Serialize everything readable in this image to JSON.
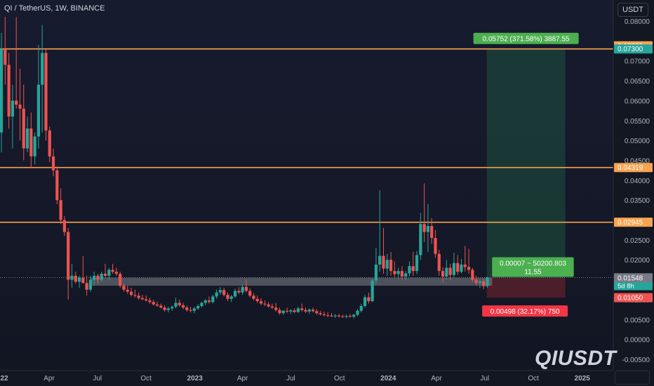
{
  "header": {
    "symbol": "QI / TetherUS, 1W, BINANCE"
  },
  "currency_button": "USDT",
  "watermark": "QIUSDT",
  "chart_data": {
    "type": "candlestick",
    "y_ticks": [
      "0.08000",
      "0.07000",
      "0.06500",
      "0.06000",
      "0.05500",
      "0.05000",
      "0.04500",
      "0.04000",
      "0.03500",
      "0.03000",
      "0.02500",
      "0.02000",
      "0.01500",
      "0.01000",
      "0.00500",
      "0.00000",
      "-0.00500"
    ],
    "x_ticks": [
      {
        "label": "22",
        "date": "2022-01",
        "bold": true
      },
      {
        "label": "Apr",
        "date": "2022-04"
      },
      {
        "label": "Jul",
        "date": "2022-07"
      },
      {
        "label": "Oct",
        "date": "2022-10"
      },
      {
        "label": "2023",
        "date": "2023-01",
        "bold": true
      },
      {
        "label": "Apr",
        "date": "2023-04"
      },
      {
        "label": "Jul",
        "date": "2023-07"
      },
      {
        "label": "Oct",
        "date": "2023-10"
      },
      {
        "label": "2024",
        "date": "2024-01",
        "bold": true
      },
      {
        "label": "Apr",
        "date": "2024-04"
      },
      {
        "label": "Jul",
        "date": "2024-07"
      },
      {
        "label": "Oct",
        "date": "2024-10"
      },
      {
        "label": "2025",
        "date": "2025-01",
        "bold": true
      }
    ],
    "ylim": [
      -0.006,
      0.081
    ],
    "horizontal_lines": [
      0.073,
      0.04319,
      0.02945
    ],
    "colors": {
      "up": "#26a69a",
      "down": "#ef5350",
      "level": "#f7a350",
      "bull": "#4caf50",
      "bear": "#f23645"
    },
    "price_labels": [
      {
        "price": "0.07378",
        "value": 0.07378,
        "color": "#f7a350"
      },
      {
        "price": "0.07300",
        "value": 0.073,
        "color": "#26a69a"
      },
      {
        "price": "0.04319",
        "value": 0.04319,
        "color": "#f7a350"
      },
      {
        "price": "0.02945",
        "value": 0.02945,
        "color": "#f7a350"
      },
      {
        "price": "0.01555",
        "sub": "5d 8h",
        "value": 0.01555,
        "color": "#26a69a"
      },
      {
        "price": "0.01548",
        "value": 0.01548,
        "color": "#787b86"
      },
      {
        "price": "0.01050",
        "value": 0.0105,
        "color": "#ef5350"
      }
    ],
    "position": {
      "entry": 0.01548,
      "target": 0.073,
      "stop": 0.0105,
      "start_date": "2024-07-05",
      "end_date": "2024-11-30",
      "target_text": "0.05752 (371.58%) 3887.55",
      "center_text_1": "0.00007 ~ 50200.803",
      "center_text_2": "11.55",
      "stop_text": "0.00498 (32.17%) 750"
    },
    "zone": {
      "low": 0.0135,
      "high": 0.0155,
      "start_date": "2022-06-18",
      "end_date": "2024-07-15"
    },
    "candles": [
      {
        "d": "2021-12-25",
        "o": 0.0765,
        "h": 0.081,
        "l": 0.0475,
        "c": 0.052
      },
      {
        "d": "2022-01-01",
        "o": 0.052,
        "h": 0.077,
        "l": 0.047,
        "c": 0.073
      },
      {
        "d": "2022-01-08",
        "o": 0.073,
        "h": 0.081,
        "l": 0.064,
        "c": 0.069
      },
      {
        "d": "2022-01-15",
        "o": 0.069,
        "h": 0.072,
        "l": 0.053,
        "c": 0.056
      },
      {
        "d": "2022-01-22",
        "o": 0.056,
        "h": 0.064,
        "l": 0.048,
        "c": 0.06
      },
      {
        "d": "2022-01-29",
        "o": 0.06,
        "h": 0.081,
        "l": 0.058,
        "c": 0.059
      },
      {
        "d": "2022-02-05",
        "o": 0.059,
        "h": 0.068,
        "l": 0.05,
        "c": 0.058
      },
      {
        "d": "2022-02-12",
        "o": 0.058,
        "h": 0.064,
        "l": 0.045,
        "c": 0.048
      },
      {
        "d": "2022-02-19",
        "o": 0.048,
        "h": 0.056,
        "l": 0.047,
        "c": 0.053
      },
      {
        "d": "2022-02-26",
        "o": 0.053,
        "h": 0.057,
        "l": 0.043,
        "c": 0.046
      },
      {
        "d": "2022-03-05",
        "o": 0.046,
        "h": 0.052,
        "l": 0.044,
        "c": 0.051
      },
      {
        "d": "2022-03-12",
        "o": 0.051,
        "h": 0.074,
        "l": 0.048,
        "c": 0.064
      },
      {
        "d": "2022-03-19",
        "o": 0.064,
        "h": 0.079,
        "l": 0.052,
        "c": 0.072
      },
      {
        "d": "2022-03-26",
        "o": 0.072,
        "h": 0.073,
        "l": 0.05,
        "c": 0.0525
      },
      {
        "d": "2022-04-02",
        "o": 0.0525,
        "h": 0.0535,
        "l": 0.0445,
        "c": 0.046
      },
      {
        "d": "2022-04-09",
        "o": 0.046,
        "h": 0.048,
        "l": 0.041,
        "c": 0.0425
      },
      {
        "d": "2022-04-16",
        "o": 0.0425,
        "h": 0.0435,
        "l": 0.034,
        "c": 0.035
      },
      {
        "d": "2022-04-23",
        "o": 0.035,
        "h": 0.038,
        "l": 0.029,
        "c": 0.03
      },
      {
        "d": "2022-04-30",
        "o": 0.03,
        "h": 0.031,
        "l": 0.026,
        "c": 0.027
      },
      {
        "d": "2022-05-07",
        "o": 0.027,
        "h": 0.028,
        "l": 0.01,
        "c": 0.015
      },
      {
        "d": "2022-05-14",
        "o": 0.015,
        "h": 0.019,
        "l": 0.013,
        "c": 0.016
      },
      {
        "d": "2022-05-21",
        "o": 0.016,
        "h": 0.017,
        "l": 0.014,
        "c": 0.0145
      },
      {
        "d": "2022-05-28",
        "o": 0.0145,
        "h": 0.016,
        "l": 0.013,
        "c": 0.0155
      },
      {
        "d": "2022-06-04",
        "o": 0.0155,
        "h": 0.021,
        "l": 0.014,
        "c": 0.0142
      },
      {
        "d": "2022-06-11",
        "o": 0.0142,
        "h": 0.016,
        "l": 0.011,
        "c": 0.0125
      },
      {
        "d": "2022-06-18",
        "o": 0.0125,
        "h": 0.016,
        "l": 0.012,
        "c": 0.015
      },
      {
        "d": "2022-06-25",
        "o": 0.015,
        "h": 0.017,
        "l": 0.0135,
        "c": 0.016
      },
      {
        "d": "2022-07-02",
        "o": 0.016,
        "h": 0.0165,
        "l": 0.014,
        "c": 0.015
      },
      {
        "d": "2022-07-09",
        "o": 0.015,
        "h": 0.017,
        "l": 0.0145,
        "c": 0.0165
      },
      {
        "d": "2022-07-16",
        "o": 0.0165,
        "h": 0.019,
        "l": 0.0155,
        "c": 0.016
      },
      {
        "d": "2022-07-23",
        "o": 0.016,
        "h": 0.018,
        "l": 0.015,
        "c": 0.0175
      },
      {
        "d": "2022-07-30",
        "o": 0.0175,
        "h": 0.019,
        "l": 0.0165,
        "c": 0.017
      },
      {
        "d": "2022-08-06",
        "o": 0.017,
        "h": 0.018,
        "l": 0.016,
        "c": 0.0165
      },
      {
        "d": "2022-08-13",
        "o": 0.0165,
        "h": 0.017,
        "l": 0.013,
        "c": 0.0135
      },
      {
        "d": "2022-08-20",
        "o": 0.0135,
        "h": 0.014,
        "l": 0.012,
        "c": 0.0125
      },
      {
        "d": "2022-08-27",
        "o": 0.0125,
        "h": 0.0135,
        "l": 0.0115,
        "c": 0.012
      },
      {
        "d": "2022-09-03",
        "o": 0.012,
        "h": 0.013,
        "l": 0.0108,
        "c": 0.0112
      },
      {
        "d": "2022-09-10",
        "o": 0.0112,
        "h": 0.0125,
        "l": 0.0105,
        "c": 0.011
      },
      {
        "d": "2022-09-17",
        "o": 0.011,
        "h": 0.0118,
        "l": 0.01,
        "c": 0.0104
      },
      {
        "d": "2022-09-24",
        "o": 0.0104,
        "h": 0.0112,
        "l": 0.0098,
        "c": 0.0101
      },
      {
        "d": "2022-10-01",
        "o": 0.0101,
        "h": 0.011,
        "l": 0.0095,
        "c": 0.0098
      },
      {
        "d": "2022-10-08",
        "o": 0.0098,
        "h": 0.0105,
        "l": 0.009,
        "c": 0.0094
      },
      {
        "d": "2022-10-15",
        "o": 0.0094,
        "h": 0.01,
        "l": 0.0085,
        "c": 0.0088
      },
      {
        "d": "2022-10-22",
        "o": 0.0088,
        "h": 0.0095,
        "l": 0.0082,
        "c": 0.0085
      },
      {
        "d": "2022-10-29",
        "o": 0.0085,
        "h": 0.009,
        "l": 0.0078,
        "c": 0.008
      },
      {
        "d": "2022-11-05",
        "o": 0.008,
        "h": 0.0086,
        "l": 0.007,
        "c": 0.0074
      },
      {
        "d": "2022-11-12",
        "o": 0.0074,
        "h": 0.0082,
        "l": 0.0068,
        "c": 0.0078
      },
      {
        "d": "2022-11-19",
        "o": 0.0078,
        "h": 0.0085,
        "l": 0.0072,
        "c": 0.0082
      },
      {
        "d": "2022-11-26",
        "o": 0.0082,
        "h": 0.0105,
        "l": 0.0078,
        "c": 0.0092
      },
      {
        "d": "2022-12-03",
        "o": 0.0092,
        "h": 0.01,
        "l": 0.0082,
        "c": 0.0086
      },
      {
        "d": "2022-12-10",
        "o": 0.0086,
        "h": 0.0092,
        "l": 0.0076,
        "c": 0.008
      },
      {
        "d": "2022-12-17",
        "o": 0.008,
        "h": 0.0085,
        "l": 0.007,
        "c": 0.0074
      },
      {
        "d": "2022-12-24",
        "o": 0.0074,
        "h": 0.0082,
        "l": 0.0068,
        "c": 0.0072
      },
      {
        "d": "2022-12-31",
        "o": 0.0072,
        "h": 0.0082,
        "l": 0.0066,
        "c": 0.0078
      },
      {
        "d": "2023-01-07",
        "o": 0.0078,
        "h": 0.0088,
        "l": 0.0074,
        "c": 0.0084
      },
      {
        "d": "2023-01-14",
        "o": 0.0084,
        "h": 0.0095,
        "l": 0.008,
        "c": 0.0092
      },
      {
        "d": "2023-01-21",
        "o": 0.0092,
        "h": 0.0102,
        "l": 0.0086,
        "c": 0.0098
      },
      {
        "d": "2023-01-28",
        "o": 0.0098,
        "h": 0.0108,
        "l": 0.009,
        "c": 0.0094
      },
      {
        "d": "2023-02-04",
        "o": 0.0094,
        "h": 0.0112,
        "l": 0.009,
        "c": 0.0108
      },
      {
        "d": "2023-02-11",
        "o": 0.0108,
        "h": 0.0125,
        "l": 0.0102,
        "c": 0.0118
      },
      {
        "d": "2023-02-18",
        "o": 0.0118,
        "h": 0.0132,
        "l": 0.0112,
        "c": 0.0124
      },
      {
        "d": "2023-02-25",
        "o": 0.0124,
        "h": 0.013,
        "l": 0.0108,
        "c": 0.0112
      },
      {
        "d": "2023-03-04",
        "o": 0.0112,
        "h": 0.0118,
        "l": 0.0096,
        "c": 0.0102
      },
      {
        "d": "2023-03-11",
        "o": 0.0102,
        "h": 0.0112,
        "l": 0.0094,
        "c": 0.0108
      },
      {
        "d": "2023-03-18",
        "o": 0.0108,
        "h": 0.0128,
        "l": 0.0104,
        "c": 0.0122
      },
      {
        "d": "2023-03-25",
        "o": 0.0122,
        "h": 0.0132,
        "l": 0.0114,
        "c": 0.0118
      },
      {
        "d": "2023-04-01",
        "o": 0.0118,
        "h": 0.0138,
        "l": 0.0112,
        "c": 0.0132
      },
      {
        "d": "2023-04-08",
        "o": 0.0132,
        "h": 0.015,
        "l": 0.0118,
        "c": 0.0122
      },
      {
        "d": "2023-04-15",
        "o": 0.0122,
        "h": 0.0128,
        "l": 0.0106,
        "c": 0.011
      },
      {
        "d": "2023-04-22",
        "o": 0.011,
        "h": 0.0116,
        "l": 0.0098,
        "c": 0.0102
      },
      {
        "d": "2023-04-29",
        "o": 0.0102,
        "h": 0.011,
        "l": 0.0092,
        "c": 0.0096
      },
      {
        "d": "2023-05-06",
        "o": 0.0096,
        "h": 0.0104,
        "l": 0.0086,
        "c": 0.009
      },
      {
        "d": "2023-05-13",
        "o": 0.009,
        "h": 0.0098,
        "l": 0.0084,
        "c": 0.0088
      },
      {
        "d": "2023-05-20",
        "o": 0.0088,
        "h": 0.0094,
        "l": 0.008,
        "c": 0.0083
      },
      {
        "d": "2023-05-27",
        "o": 0.0083,
        "h": 0.009,
        "l": 0.0076,
        "c": 0.008
      },
      {
        "d": "2023-06-03",
        "o": 0.008,
        "h": 0.0092,
        "l": 0.007,
        "c": 0.0074
      },
      {
        "d": "2023-06-10",
        "o": 0.0074,
        "h": 0.008,
        "l": 0.0062,
        "c": 0.0066
      },
      {
        "d": "2023-06-17",
        "o": 0.0066,
        "h": 0.0074,
        "l": 0.0062,
        "c": 0.0072
      },
      {
        "d": "2023-06-24",
        "o": 0.0072,
        "h": 0.008,
        "l": 0.0066,
        "c": 0.007
      },
      {
        "d": "2023-07-01",
        "o": 0.007,
        "h": 0.0076,
        "l": 0.0064,
        "c": 0.0073
      },
      {
        "d": "2023-07-08",
        "o": 0.0073,
        "h": 0.0078,
        "l": 0.0066,
        "c": 0.0069
      },
      {
        "d": "2023-07-15",
        "o": 0.0069,
        "h": 0.0082,
        "l": 0.0066,
        "c": 0.0078
      },
      {
        "d": "2023-07-22",
        "o": 0.0078,
        "h": 0.009,
        "l": 0.007,
        "c": 0.0074
      },
      {
        "d": "2023-07-29",
        "o": 0.0074,
        "h": 0.008,
        "l": 0.0066,
        "c": 0.007
      },
      {
        "d": "2023-08-05",
        "o": 0.007,
        "h": 0.0078,
        "l": 0.0064,
        "c": 0.0075
      },
      {
        "d": "2023-08-12",
        "o": 0.0075,
        "h": 0.008,
        "l": 0.0068,
        "c": 0.0071
      },
      {
        "d": "2023-08-19",
        "o": 0.0071,
        "h": 0.0076,
        "l": 0.0062,
        "c": 0.0066
      },
      {
        "d": "2023-08-26",
        "o": 0.0066,
        "h": 0.0072,
        "l": 0.006,
        "c": 0.0063
      },
      {
        "d": "2023-09-02",
        "o": 0.0063,
        "h": 0.007,
        "l": 0.0058,
        "c": 0.0061
      },
      {
        "d": "2023-09-09",
        "o": 0.0061,
        "h": 0.0068,
        "l": 0.0056,
        "c": 0.006
      },
      {
        "d": "2023-09-16",
        "o": 0.006,
        "h": 0.0066,
        "l": 0.0056,
        "c": 0.0058
      },
      {
        "d": "2023-09-23",
        "o": 0.0058,
        "h": 0.0064,
        "l": 0.0054,
        "c": 0.006
      },
      {
        "d": "2023-09-30",
        "o": 0.006,
        "h": 0.0064,
        "l": 0.0055,
        "c": 0.0058
      },
      {
        "d": "2023-10-07",
        "o": 0.0058,
        "h": 0.0062,
        "l": 0.0054,
        "c": 0.0057
      },
      {
        "d": "2023-10-14",
        "o": 0.0057,
        "h": 0.0062,
        "l": 0.0053,
        "c": 0.0059
      },
      {
        "d": "2023-10-21",
        "o": 0.0059,
        "h": 0.0064,
        "l": 0.0055,
        "c": 0.0057
      },
      {
        "d": "2023-10-28",
        "o": 0.0057,
        "h": 0.0064,
        "l": 0.0053,
        "c": 0.0062
      },
      {
        "d": "2023-11-04",
        "o": 0.0062,
        "h": 0.0076,
        "l": 0.0058,
        "c": 0.0072
      },
      {
        "d": "2023-11-11",
        "o": 0.0072,
        "h": 0.009,
        "l": 0.0068,
        "c": 0.0084
      },
      {
        "d": "2023-11-18",
        "o": 0.0084,
        "h": 0.0112,
        "l": 0.008,
        "c": 0.0106
      },
      {
        "d": "2023-11-25",
        "o": 0.0106,
        "h": 0.0118,
        "l": 0.009,
        "c": 0.0096
      },
      {
        "d": "2023-12-02",
        "o": 0.0096,
        "h": 0.0152,
        "l": 0.0094,
        "c": 0.0148
      },
      {
        "d": "2023-12-09",
        "o": 0.0148,
        "h": 0.023,
        "l": 0.014,
        "c": 0.0188
      },
      {
        "d": "2023-12-16",
        "o": 0.0188,
        "h": 0.0375,
        "l": 0.017,
        "c": 0.021
      },
      {
        "d": "2023-12-23",
        "o": 0.021,
        "h": 0.028,
        "l": 0.0165,
        "c": 0.0178
      },
      {
        "d": "2023-12-30",
        "o": 0.0178,
        "h": 0.0215,
        "l": 0.016,
        "c": 0.02
      },
      {
        "d": "2024-01-06",
        "o": 0.02,
        "h": 0.022,
        "l": 0.016,
        "c": 0.0172
      },
      {
        "d": "2024-01-13",
        "o": 0.0172,
        "h": 0.0196,
        "l": 0.0156,
        "c": 0.0164
      },
      {
        "d": "2024-01-20",
        "o": 0.0164,
        "h": 0.018,
        "l": 0.0152,
        "c": 0.0172
      },
      {
        "d": "2024-01-27",
        "o": 0.0172,
        "h": 0.0184,
        "l": 0.015,
        "c": 0.0158
      },
      {
        "d": "2024-02-03",
        "o": 0.0158,
        "h": 0.0172,
        "l": 0.0148,
        "c": 0.0166
      },
      {
        "d": "2024-02-10",
        "o": 0.0166,
        "h": 0.0196,
        "l": 0.0158,
        "c": 0.0184
      },
      {
        "d": "2024-02-17",
        "o": 0.0184,
        "h": 0.022,
        "l": 0.016,
        "c": 0.0172
      },
      {
        "d": "2024-02-24",
        "o": 0.0172,
        "h": 0.0222,
        "l": 0.0164,
        "c": 0.0212
      },
      {
        "d": "2024-03-02",
        "o": 0.0212,
        "h": 0.0318,
        "l": 0.02,
        "c": 0.029
      },
      {
        "d": "2024-03-09",
        "o": 0.029,
        "h": 0.0392,
        "l": 0.0245,
        "c": 0.027
      },
      {
        "d": "2024-03-16",
        "o": 0.027,
        "h": 0.034,
        "l": 0.022,
        "c": 0.0285
      },
      {
        "d": "2024-03-23",
        "o": 0.0285,
        "h": 0.0305,
        "l": 0.024,
        "c": 0.0255
      },
      {
        "d": "2024-03-30",
        "o": 0.0255,
        "h": 0.0275,
        "l": 0.0205,
        "c": 0.0215
      },
      {
        "d": "2024-04-06",
        "o": 0.0215,
        "h": 0.0225,
        "l": 0.016,
        "c": 0.0172
      },
      {
        "d": "2024-04-13",
        "o": 0.0172,
        "h": 0.0182,
        "l": 0.0142,
        "c": 0.0158
      },
      {
        "d": "2024-04-20",
        "o": 0.0158,
        "h": 0.02,
        "l": 0.015,
        "c": 0.018
      },
      {
        "d": "2024-04-27",
        "o": 0.018,
        "h": 0.019,
        "l": 0.0148,
        "c": 0.0162
      },
      {
        "d": "2024-05-04",
        "o": 0.0162,
        "h": 0.0218,
        "l": 0.0156,
        "c": 0.0192
      },
      {
        "d": "2024-05-11",
        "o": 0.0192,
        "h": 0.0212,
        "l": 0.0162,
        "c": 0.017
      },
      {
        "d": "2024-05-18",
        "o": 0.017,
        "h": 0.0202,
        "l": 0.0166,
        "c": 0.0188
      },
      {
        "d": "2024-05-25",
        "o": 0.0188,
        "h": 0.0235,
        "l": 0.017,
        "c": 0.0182
      },
      {
        "d": "2024-06-01",
        "o": 0.0182,
        "h": 0.0228,
        "l": 0.0165,
        "c": 0.0175
      },
      {
        "d": "2024-06-08",
        "o": 0.0175,
        "h": 0.018,
        "l": 0.0145,
        "c": 0.015
      },
      {
        "d": "2024-06-15",
        "o": 0.015,
        "h": 0.016,
        "l": 0.0135,
        "c": 0.0142
      },
      {
        "d": "2024-06-22",
        "o": 0.0142,
        "h": 0.015,
        "l": 0.013,
        "c": 0.0146
      },
      {
        "d": "2024-06-29",
        "o": 0.0146,
        "h": 0.0152,
        "l": 0.0126,
        "c": 0.0134
      },
      {
        "d": "2024-07-06",
        "o": 0.0134,
        "h": 0.0158,
        "l": 0.013,
        "c": 0.01555
      }
    ]
  }
}
